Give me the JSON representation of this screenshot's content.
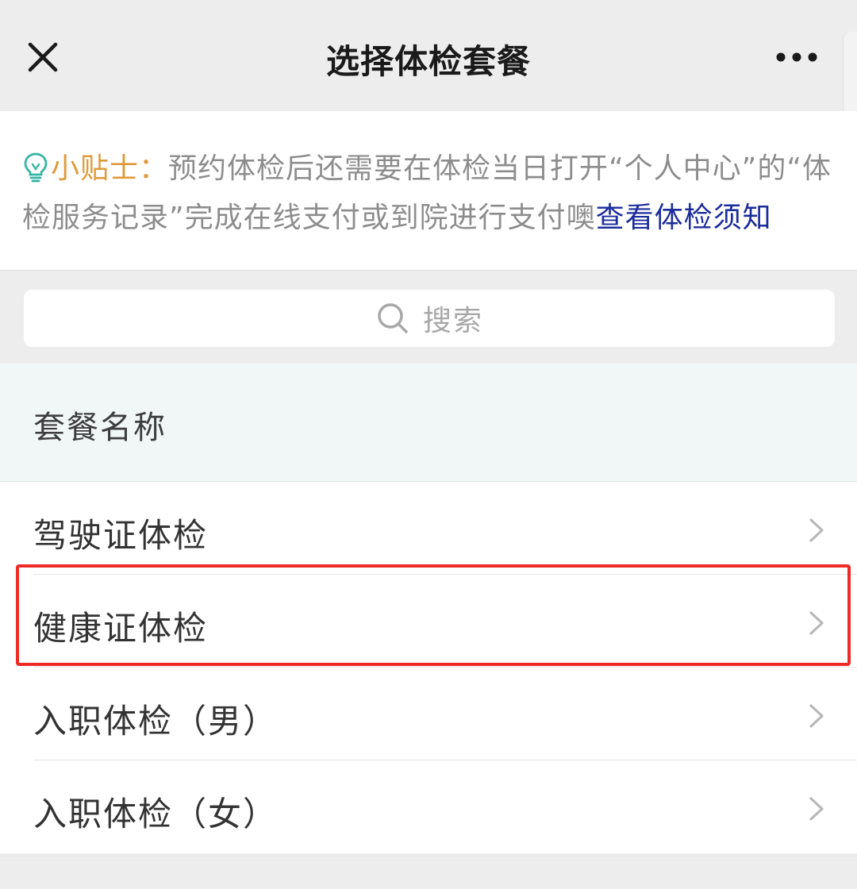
{
  "navbar": {
    "title": "选择体检套餐",
    "close_icon": "close-icon",
    "more_icon": "more-dots-icon"
  },
  "tip": {
    "icon": "lightbulb-icon",
    "label": "小贴士：",
    "body": "预约体检后还需要在体检当日打开“个人中心”的“体检服务记录”完成在线支付或到院进行支付噢",
    "link": "查看体检须知",
    "colors": {
      "label": "#e09a3a",
      "link": "#1b2c9c",
      "icon": "#35b5a4"
    }
  },
  "search": {
    "placeholder": "搜索",
    "icon": "search-icon"
  },
  "package_list": {
    "header": "套餐名称",
    "items": [
      {
        "label": "驾驶证体检"
      },
      {
        "label": "健康证体检",
        "highlighted": true
      },
      {
        "label": "入职体检（男）"
      },
      {
        "label": "入职体检（女）"
      }
    ],
    "item_icon": "chevron-right-icon",
    "highlight_color": "#ee2a26"
  }
}
